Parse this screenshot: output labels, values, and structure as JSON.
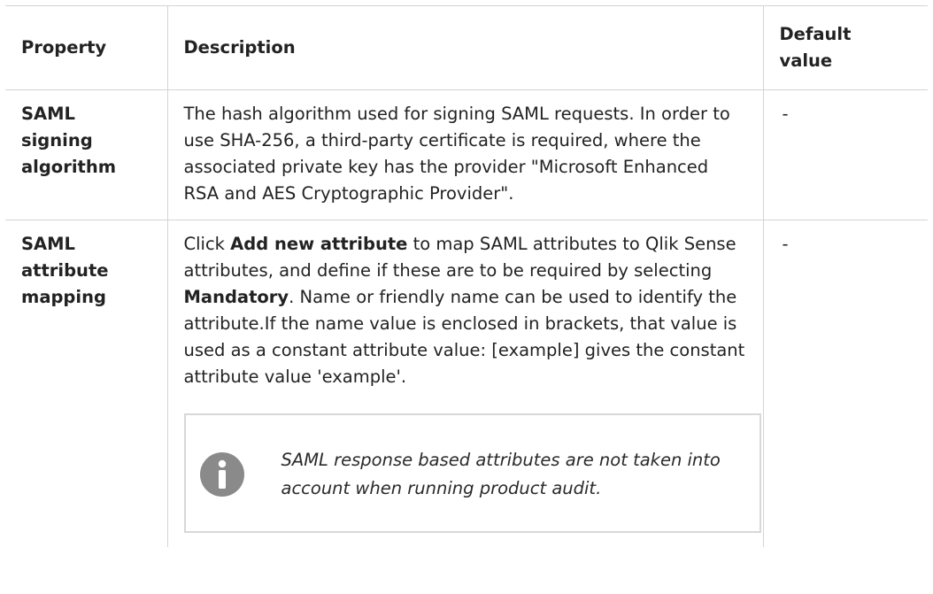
{
  "table": {
    "headers": {
      "property": "Property",
      "description": "Description",
      "default_value": "Default value"
    },
    "rows": [
      {
        "property": "SAML signing algorithm",
        "description": "The hash algorithm used for signing SAML requests. In order to use SHA-256, a third-party certificate is required, where the associated private key has the provider \"Microsoft Enhanced RSA and AES Cryptographic Provider\".",
        "default_value": "-"
      },
      {
        "property": "SAML attribute mapping",
        "description_parts": {
          "p1": "Click ",
          "b1": "Add new attribute",
          "p2": " to map SAML attributes to Qlik Sense attributes, and define if these are to be required by selecting ",
          "b2": "Mandatory",
          "p3": ". Name or friendly name can be used to identify the attribute.If the name value is enclosed in brackets, that value is used as a constant attribute value: [example] gives the constant attribute value 'example'."
        },
        "note": {
          "icon": "info-icon",
          "text": "SAML response based attributes are not taken into account when running product audit."
        },
        "default_value": "-"
      }
    ]
  },
  "colors": {
    "border": "#d4d4d4",
    "note_border": "#d8d8d8",
    "icon": "#8a8a8a",
    "text": "#222222"
  }
}
